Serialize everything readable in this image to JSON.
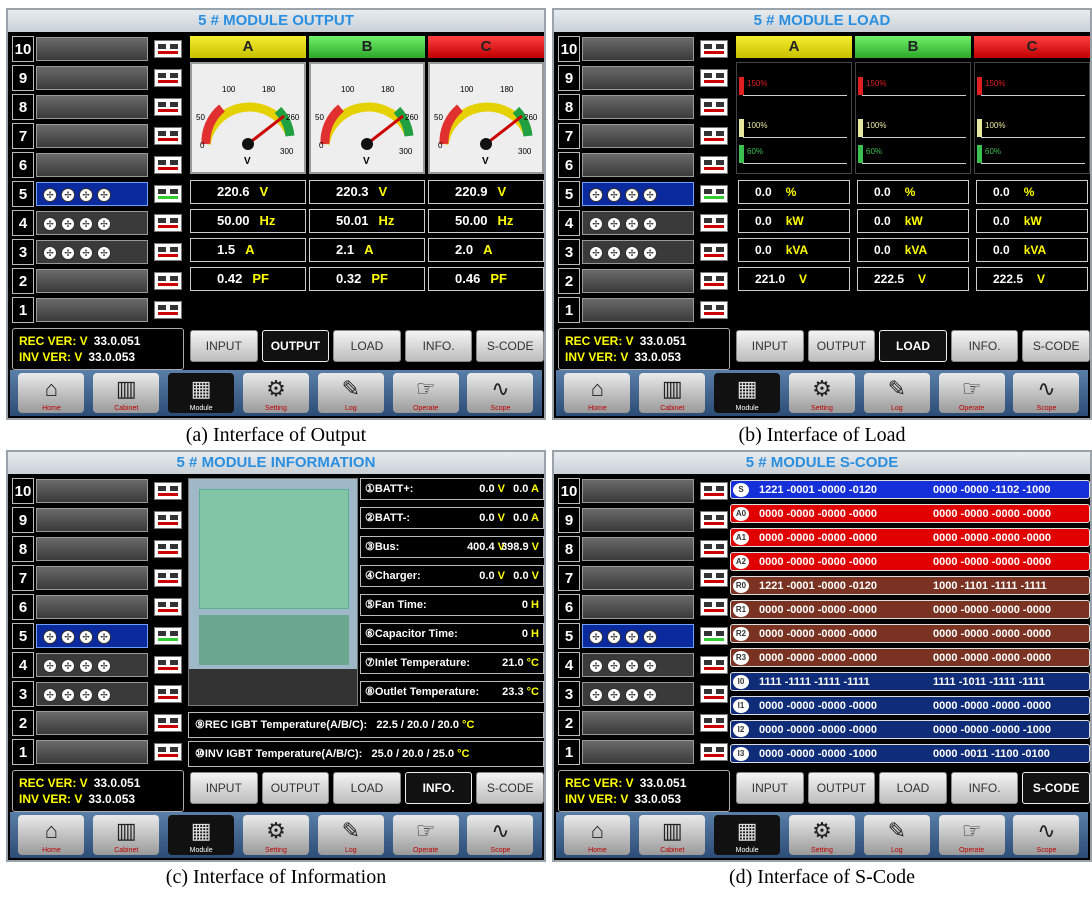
{
  "modules": [
    "10",
    "9",
    "8",
    "7",
    "6",
    "5",
    "4",
    "3",
    "2",
    "1"
  ],
  "version": {
    "rec_label": "REC VER: V",
    "rec_value": "33.0.051",
    "inv_label": "INV VER: V",
    "inv_value": "33.0.053"
  },
  "tabs": [
    "INPUT",
    "OUTPUT",
    "LOAD",
    "INFO.",
    "S-CODE"
  ],
  "nav": [
    "Home",
    "Cabinet",
    "Module",
    "Setting",
    "Log",
    "Operate",
    "Scope"
  ],
  "panel_a": {
    "title": "5 # MODULE OUTPUT",
    "phases": [
      "A",
      "B",
      "C"
    ],
    "gauge_ticks": [
      "100",
      "180",
      "50",
      "260",
      "0",
      "300",
      "V"
    ],
    "voltage": [
      "220.6",
      "220.3",
      "220.9"
    ],
    "freq": [
      "50.00",
      "50.01",
      "50.00"
    ],
    "current": [
      "1.5",
      "2.1",
      "2.0"
    ],
    "pf": [
      "0.42",
      "0.32",
      "0.46"
    ],
    "units": {
      "v": "V",
      "hz": "Hz",
      "a": "A",
      "pf": "PF"
    },
    "caption": "(a) Interface of Output"
  },
  "panel_b": {
    "title": "5  # MODULE LOAD",
    "phases": [
      "A",
      "B",
      "C"
    ],
    "levels": [
      "150%",
      "100%",
      "60%"
    ],
    "load_pct": [
      "0.0",
      "0.0",
      "0.0"
    ],
    "kw": [
      "0.0",
      "0.0",
      "0.0"
    ],
    "kva": [
      "0.0",
      "0.0",
      "0.0"
    ],
    "volt": [
      "221.0",
      "222.5",
      "222.5"
    ],
    "units": {
      "pct": "%",
      "kw": "kW",
      "kva": "kVA",
      "v": "V"
    },
    "caption": "(b) Interface of Load"
  },
  "panel_c": {
    "title": "5 # MODULE INFORMATION",
    "rows": [
      {
        "k": "①BATT+:",
        "v1": "0.0",
        "u1": "V",
        "v2": "0.0",
        "u2": "A"
      },
      {
        "k": "②BATT-:",
        "v1": "0.0",
        "u1": "V",
        "v2": "0.0",
        "u2": "A"
      },
      {
        "k": "③Bus:",
        "v1": "400.4",
        "u1": "V",
        "v2": "398.9",
        "u2": "V"
      },
      {
        "k": "④Charger:",
        "v1": "0.0",
        "u1": "V",
        "v2": "0.0",
        "u2": "V"
      },
      {
        "k": "⑤Fan Time:",
        "v1": "",
        "u1": "",
        "v2": "0",
        "u2": "H"
      },
      {
        "k": "⑥Capacitor Time:",
        "v1": "",
        "u1": "",
        "v2": "0",
        "u2": "H"
      },
      {
        "k": "⑦Inlet Temperature:",
        "v1": "",
        "u1": "",
        "v2": "21.0",
        "u2": "°C"
      },
      {
        "k": "⑧Outlet Temperature:",
        "v1": "",
        "u1": "",
        "v2": "23.3",
        "u2": "°C"
      }
    ],
    "igbt_rec": {
      "label": "⑨REC IGBT Temperature(A/B/C):",
      "vals": "22.5  /  20.0 /   20.0",
      "u": "°C"
    },
    "igbt_inv": {
      "label": "⑩INV IGBT Temperature(A/B/C):",
      "vals": "25.0  /  20.0 /   25.0",
      "u": "°C"
    },
    "caption": "(c) Interface of Information"
  },
  "panel_d": {
    "title": "5  # MODULE S-CODE",
    "rows": [
      {
        "tag": "S",
        "c1": "1221 -0001 -0000 -0120",
        "c2": "0000 -0000 -1102 -1000",
        "color": "#1530d8"
      },
      {
        "tag": "A0",
        "c1": "0000 -0000 -0000 -0000",
        "c2": "0000 -0000 -0000 -0000",
        "color": "#e00000"
      },
      {
        "tag": "A1",
        "c1": "0000 -0000 -0000 -0000",
        "c2": "0000 -0000 -0000 -0000",
        "color": "#e00000"
      },
      {
        "tag": "A2",
        "c1": "0000 -0000 -0000 -0000",
        "c2": "0000 -0000 -0000 -0000",
        "color": "#e00000"
      },
      {
        "tag": "R0",
        "c1": "1221 -0001 -0000 -0120",
        "c2": "1000 -1101 -1111 -1111",
        "color": "#7a3322"
      },
      {
        "tag": "R1",
        "c1": "0000 -0000 -0000 -0000",
        "c2": "0000 -0000 -0000 -0000",
        "color": "#7a3322"
      },
      {
        "tag": "R2",
        "c1": "0000 -0000 -0000 -0000",
        "c2": "0000 -0000 -0000 -0000",
        "color": "#7a3322"
      },
      {
        "tag": "R3",
        "c1": "0000 -0000 -0000 -0000",
        "c2": "0000 -0000 -0000 -0000",
        "color": "#7a3322"
      },
      {
        "tag": "I0",
        "c1": "1111 -1111 -1111 -1111",
        "c2": "1111 -1011 -1111 -1111",
        "color": "#0e2c78"
      },
      {
        "tag": "I1",
        "c1": "0000 -0000 -0000 -0000",
        "c2": "0000 -0000 -0000 -0000",
        "color": "#0e2c78"
      },
      {
        "tag": "I2",
        "c1": "0000 -0000 -0000 -0000",
        "c2": "0000 -0000 -0000 -1000",
        "color": "#0e2c78"
      },
      {
        "tag": "I3",
        "c1": "0000 -0000 -0000 -1000",
        "c2": "0000 -0011 -1100 -0100",
        "color": "#0e2c78"
      }
    ],
    "caption": "(d) Interface of S-Code"
  }
}
